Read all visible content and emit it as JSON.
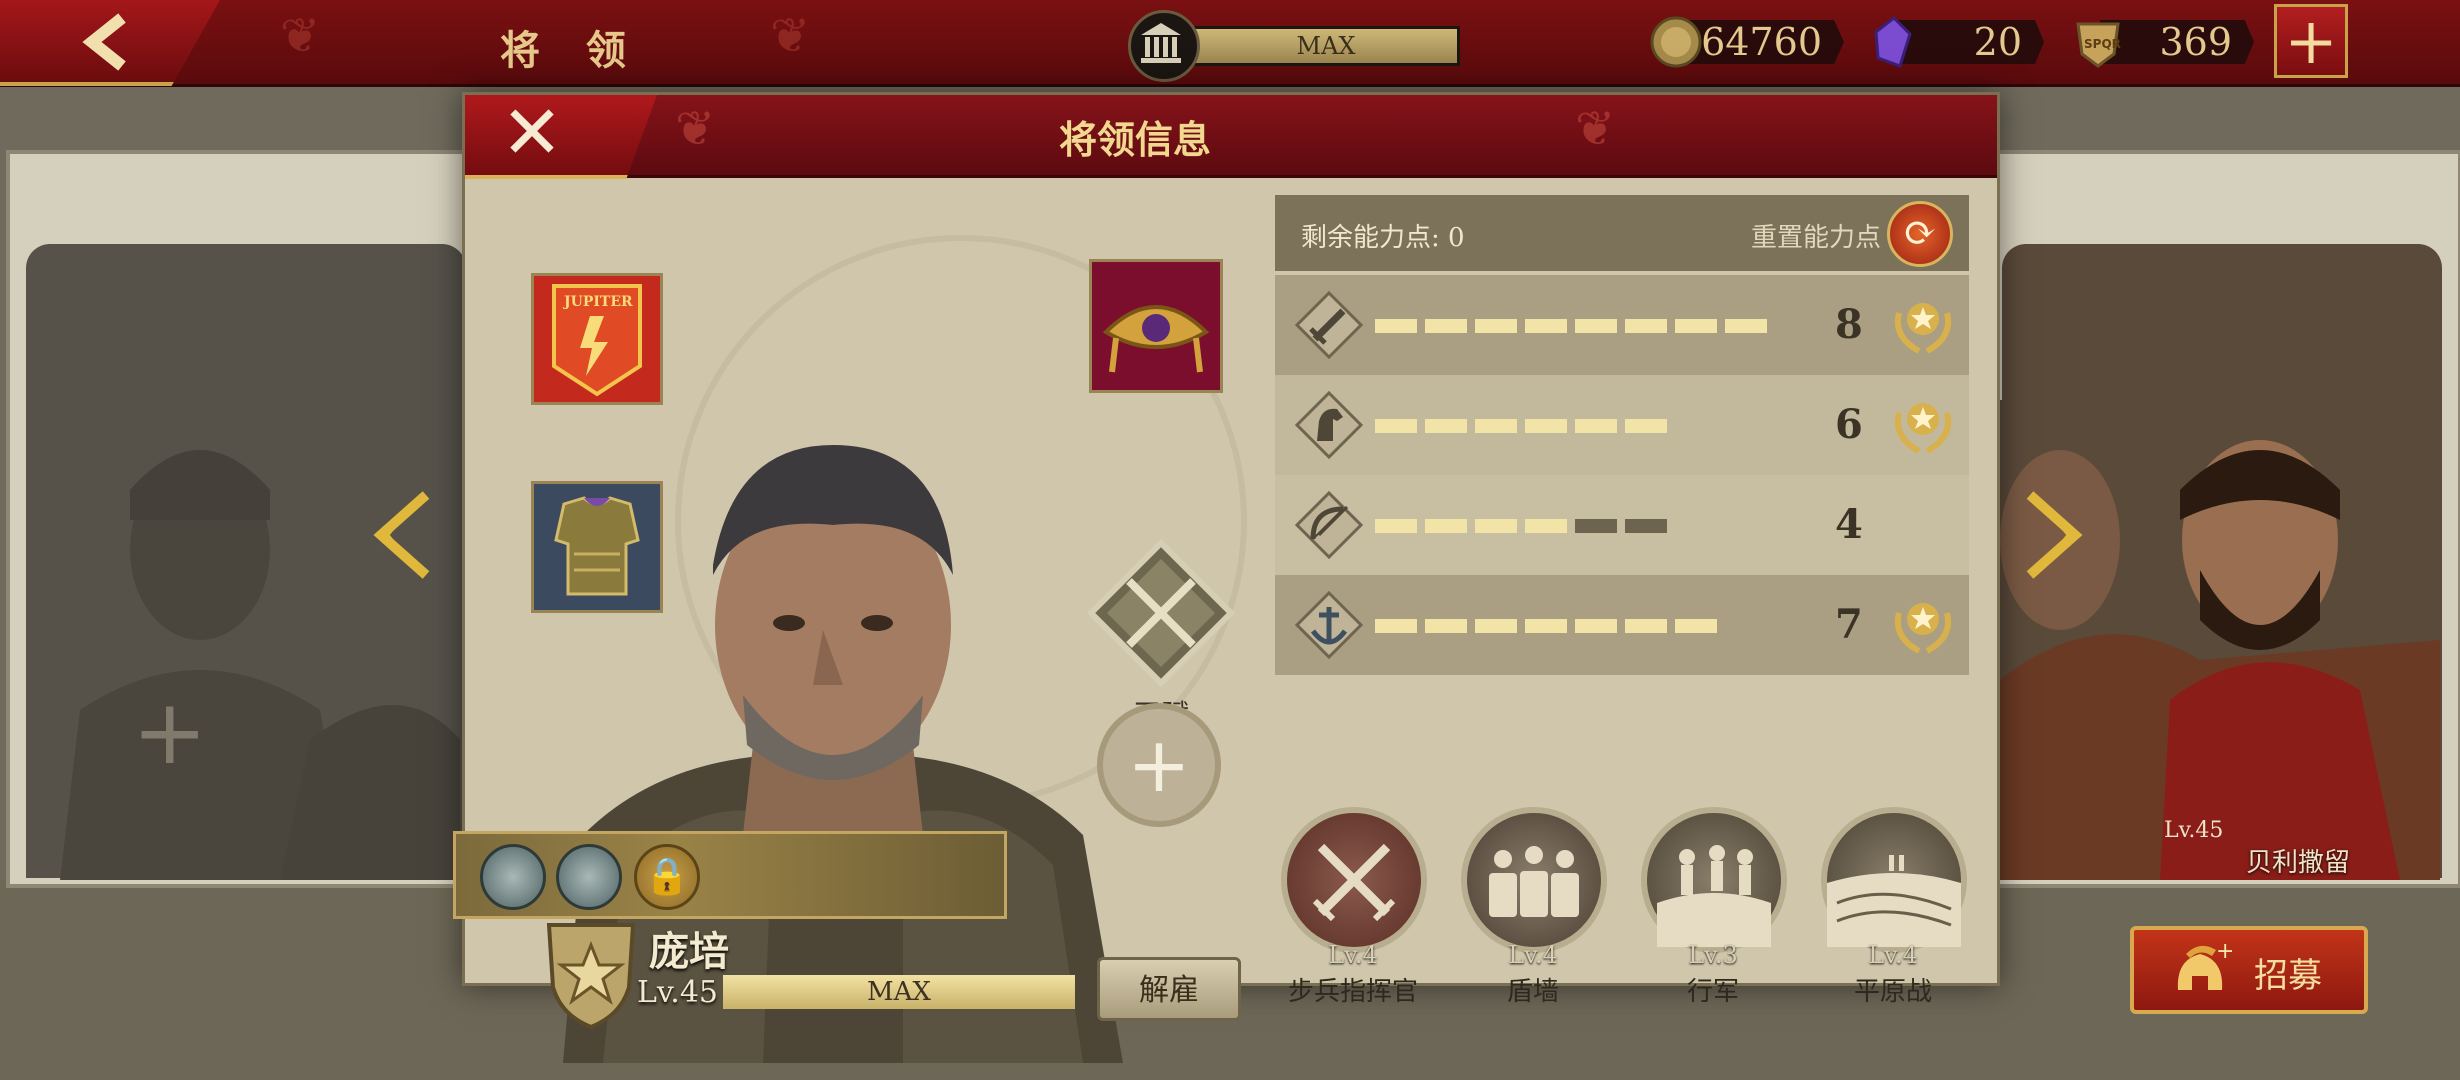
{
  "topbar": {
    "title": "将 领",
    "building_level": "MAX",
    "resources": [
      {
        "icon": "coin-icon",
        "value": "64760"
      },
      {
        "icon": "purple-crystal-icon",
        "value": "20"
      },
      {
        "icon": "spqr-emblem-icon",
        "value": "369"
      }
    ],
    "add_label": "+"
  },
  "modal": {
    "title": "将领信息",
    "close_label": "✕",
    "talent_label": "天赋",
    "add_slot_label": "+",
    "general": {
      "name": "庞培",
      "level": "Lv.45",
      "xp_label": "MAX"
    },
    "dismiss_label": "解雇",
    "points": {
      "label": "剩余能力点:  0",
      "reset_label": "重置能力点"
    },
    "attributes": [
      {
        "icon": "sword-icon",
        "value": "8",
        "filled": 8,
        "total": 8,
        "medal": true
      },
      {
        "icon": "horse-icon",
        "value": "6",
        "filled": 6,
        "total": 6,
        "medal": true
      },
      {
        "icon": "bow-icon",
        "value": "4",
        "filled": 4,
        "total": 6,
        "medal": false
      },
      {
        "icon": "anchor-icon",
        "value": "7",
        "filled": 7,
        "total": 7,
        "medal": true
      }
    ],
    "skills": [
      {
        "icon": "crossed-swords-icon",
        "level": "Lv.4",
        "name": "步兵指挥官"
      },
      {
        "icon": "shield-wall-icon",
        "level": "Lv.4",
        "name": "盾墙"
      },
      {
        "icon": "marching-soldiers-icon",
        "level": "Lv.3",
        "name": "行军"
      },
      {
        "icon": "plains-icon",
        "level": "Lv.4",
        "name": "平原战"
      }
    ]
  },
  "side_card": {
    "level": "Lv.45",
    "name": "贝利撒留"
  },
  "recruit_label": "招募",
  "colors": {
    "accent_red": "#7a1012",
    "gold": "#d9b25a",
    "bar_fill": "#f2e3a6",
    "bar_empty": "#6d6450"
  }
}
